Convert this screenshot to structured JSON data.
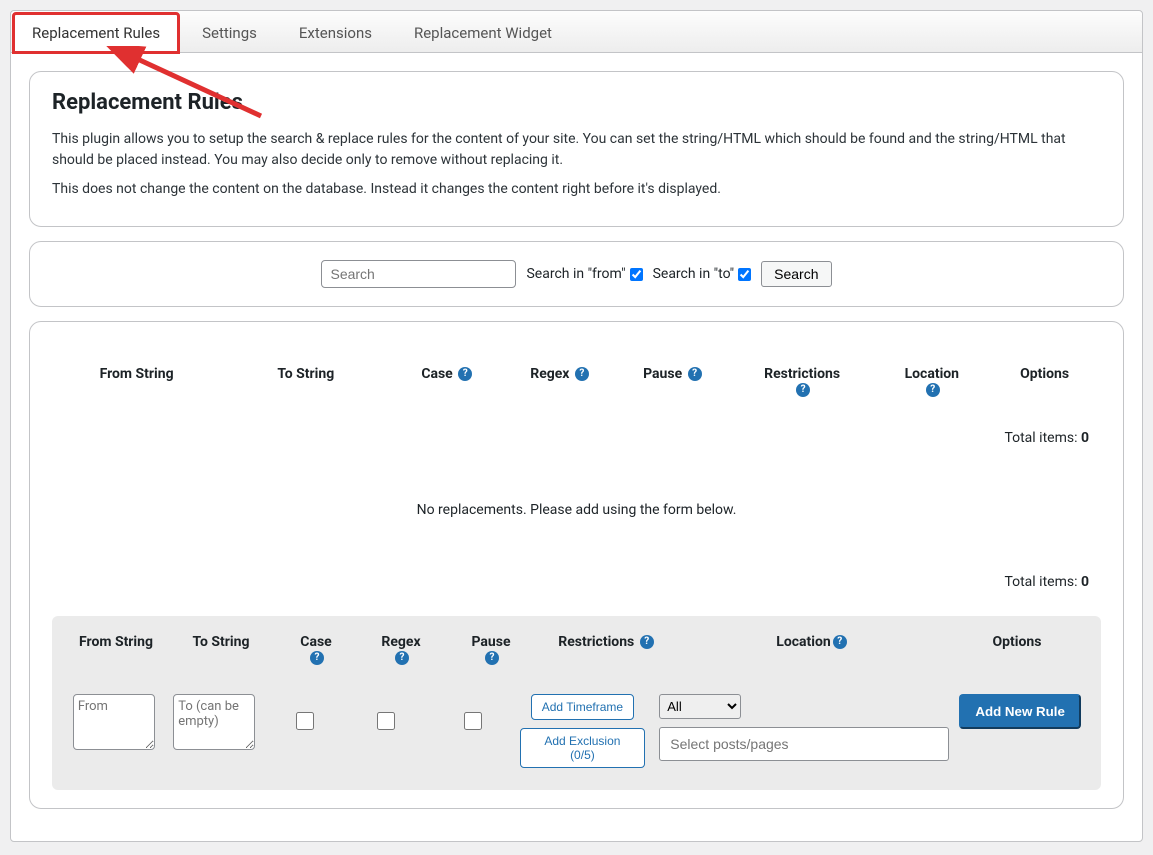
{
  "tabs": [
    "Replacement Rules",
    "Settings",
    "Extensions",
    "Replacement Widget"
  ],
  "intro": {
    "heading": "Replacement Rules",
    "p1": "This plugin allows you to setup the search & replace rules for the content of your site. You can set the string/HTML which should be found and the string/HTML that should be placed instead. You may also decide only to remove without replacing it.",
    "p2": "This does not change the content on the database. Instead it changes the content right before it's displayed."
  },
  "search": {
    "placeholder": "Search",
    "from_label": "Search in \"from\"",
    "to_label": "Search in \"to\"",
    "from_checked": true,
    "to_checked": true,
    "button": "Search"
  },
  "table": {
    "headers": {
      "from": "From String",
      "to": "To String",
      "case": "Case",
      "regex": "Regex",
      "pause": "Pause",
      "restrictions": "Restrictions",
      "location": "Location",
      "options": "Options"
    },
    "total_label": "Total items: ",
    "total_count": "0",
    "empty_message": "No replacements. Please add using the form below."
  },
  "form": {
    "headers": {
      "from": "From String",
      "to": "To String",
      "case": "Case",
      "regex": "Regex",
      "pause": "Pause",
      "restrictions": "Restrictions",
      "location": "Location",
      "options": "Options"
    },
    "from_placeholder": "From",
    "to_placeholder": "To (can be empty)",
    "add_timeframe": "Add Timeframe",
    "add_exclusion": "Add Exclusion (0/5)",
    "location_select": "All",
    "location_placeholder": "Select posts/pages",
    "submit": "Add New Rule"
  }
}
